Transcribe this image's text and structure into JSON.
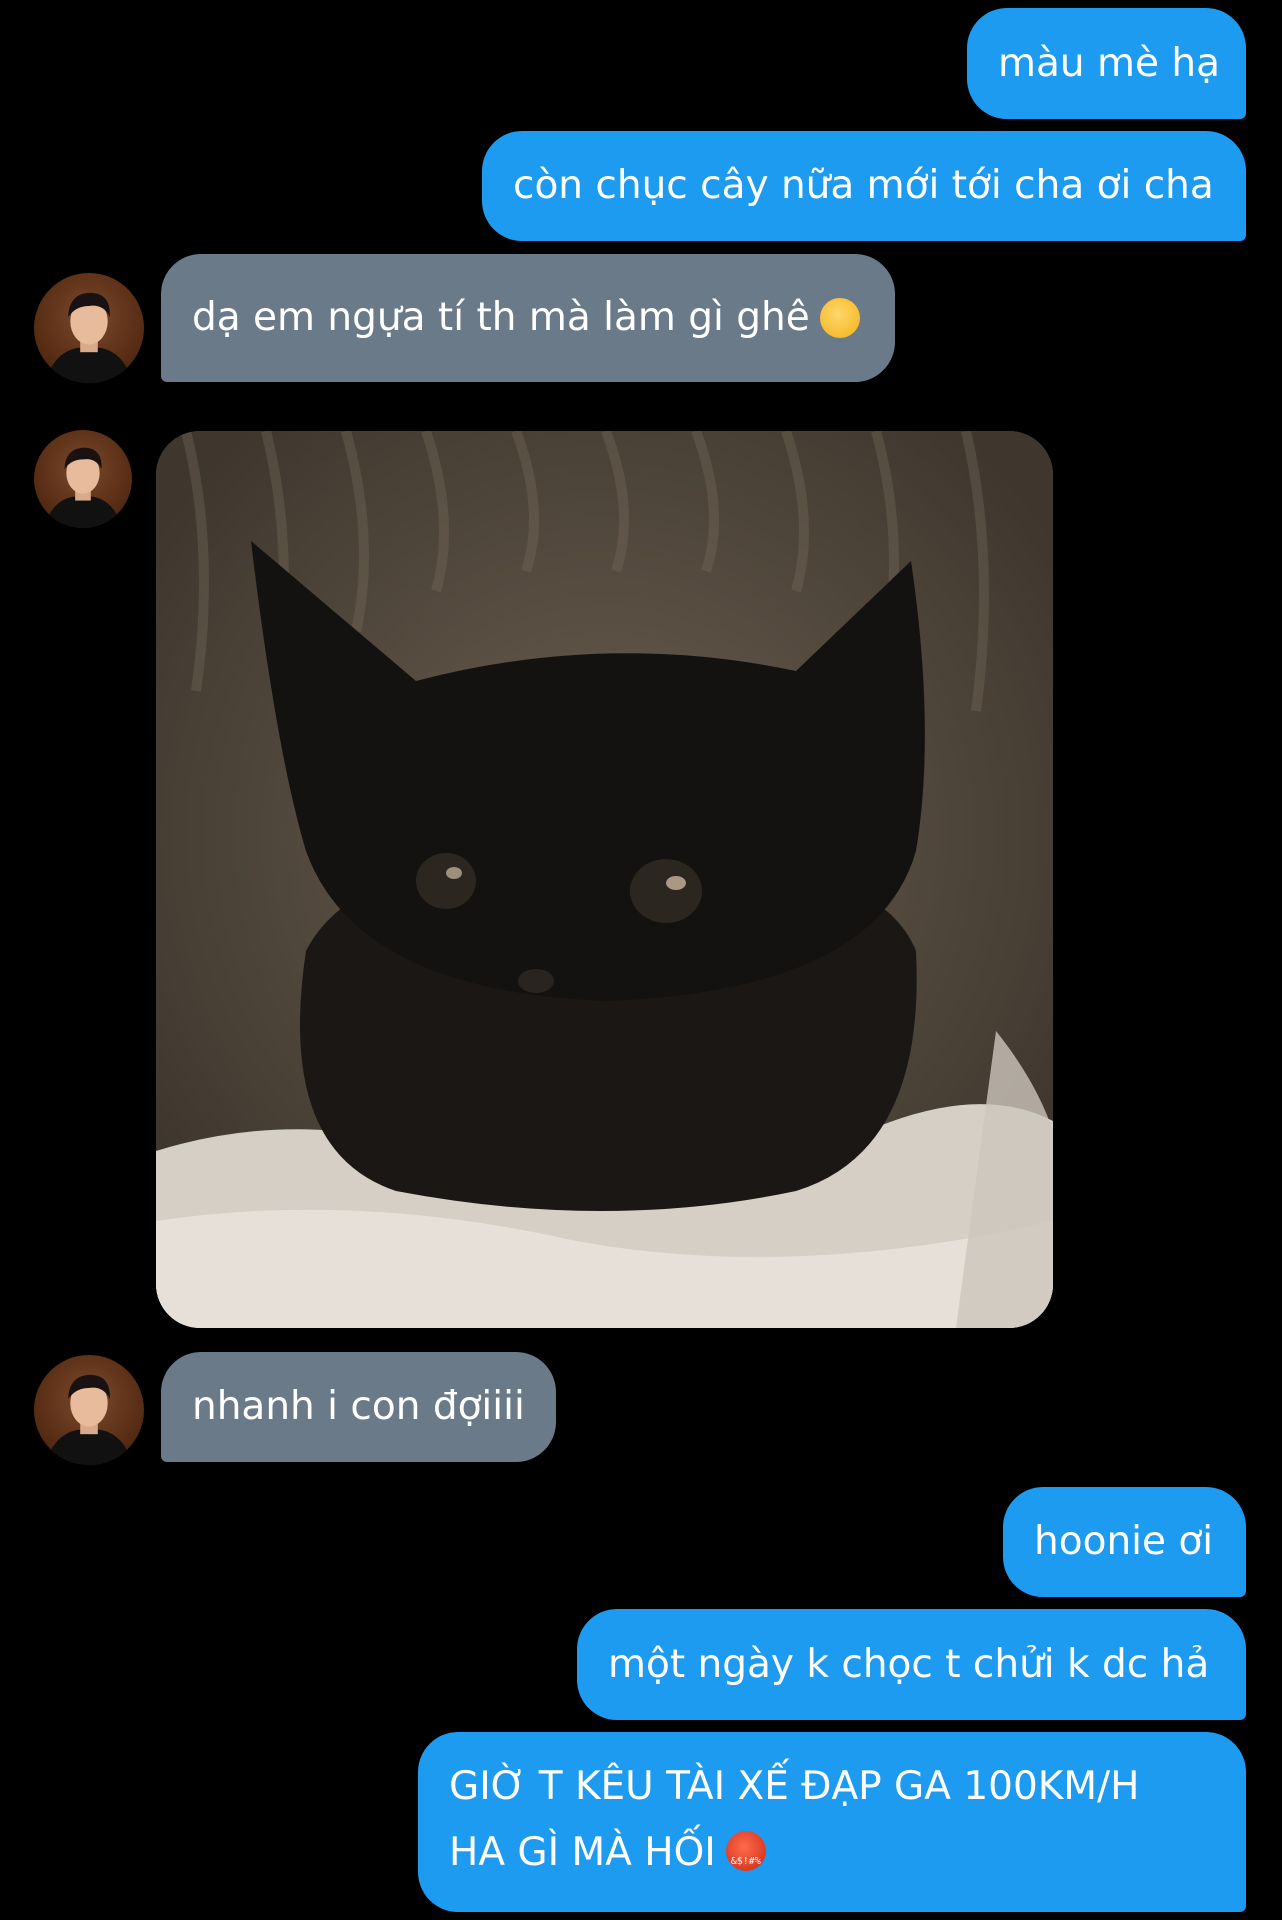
{
  "messages": [
    {
      "sender": "me",
      "text": "màu mè hạ"
    },
    {
      "sender": "me",
      "text": "còn chục cây nữa mới tới cha ơi cha"
    },
    {
      "sender": "them",
      "text": "dạ em ngựa tí th mà làm gì ghê",
      "emoji": "pensive-face"
    },
    {
      "sender": "them",
      "type": "image",
      "description_icon": "black-kitten-photo"
    },
    {
      "sender": "them",
      "text": "nhanh i con đợiiii"
    },
    {
      "sender": "me",
      "text": "hoonie ơi"
    },
    {
      "sender": "me",
      "text": "một ngày k chọc t chửi k dc hả"
    },
    {
      "sender": "me",
      "line1": "GIỜ T KÊU TÀI XẾ ĐẠP GA 100KM/H",
      "line2": "HA GÌ MÀ HỐI",
      "emoji": "face-with-symbols-on-mouth",
      "emoji_symbols": "&$!#%"
    }
  ],
  "colors": {
    "background": "#000000",
    "outgoing_bubble": "#1d9bf0",
    "incoming_bubble": "#6b7a89",
    "text": "#ffffff"
  }
}
